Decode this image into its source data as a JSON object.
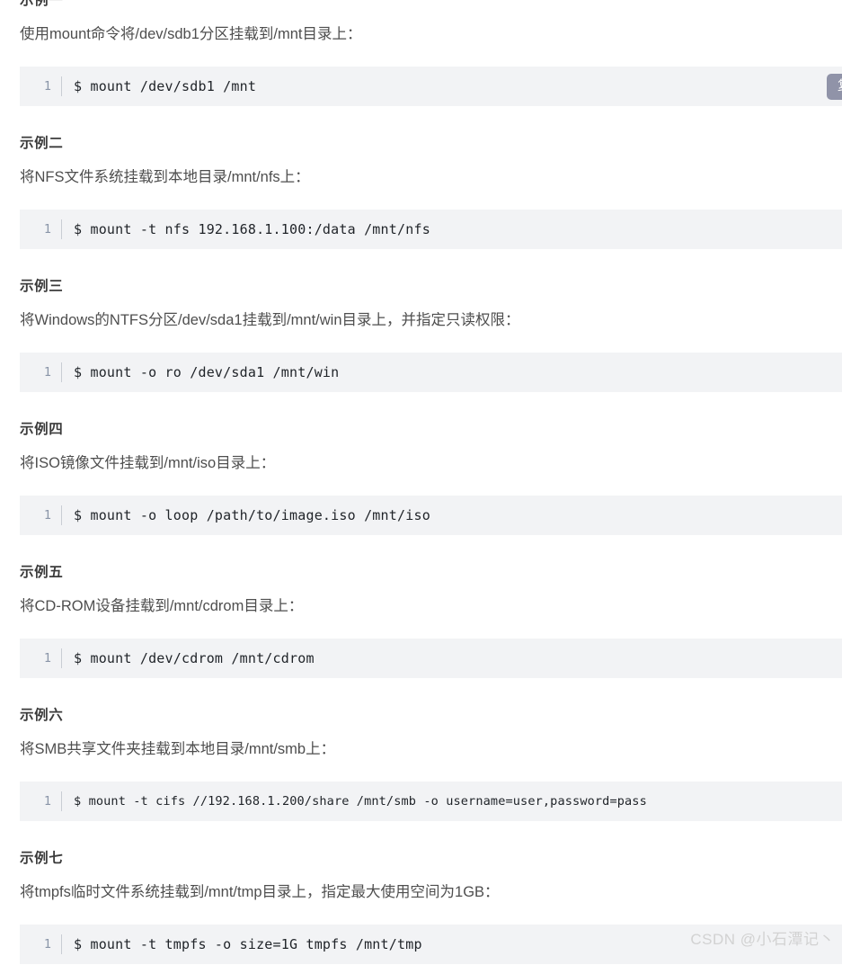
{
  "sections": [
    {
      "heading": "示例一",
      "description": "使用mount命令将/dev/sdb1分区挂载到/mnt目录上：",
      "code": {
        "line_number": "1",
        "text": "$ mount /dev/sdb1 /mnt",
        "size": "normal"
      },
      "copy_button_label": "复制"
    },
    {
      "heading": "示例二",
      "description": "将NFS文件系统挂载到本地目录/mnt/nfs上：",
      "code": {
        "line_number": "1",
        "text": "$ mount -t nfs 192.168.1.100:/data /mnt/nfs",
        "size": "normal"
      }
    },
    {
      "heading": "示例三",
      "description": "将Windows的NTFS分区/dev/sda1挂载到/mnt/win目录上，并指定只读权限：",
      "code": {
        "line_number": "1",
        "text": "$ mount -o ro /dev/sda1 /mnt/win",
        "size": "normal"
      }
    },
    {
      "heading": "示例四",
      "description": "将ISO镜像文件挂载到/mnt/iso目录上：",
      "code": {
        "line_number": "1",
        "text": "$ mount -o loop /path/to/image.iso /mnt/iso",
        "size": "normal"
      }
    },
    {
      "heading": "示例五",
      "description": "将CD-ROM设备挂载到/mnt/cdrom目录上：",
      "code": {
        "line_number": "1",
        "text": "$ mount /dev/cdrom /mnt/cdrom",
        "size": "normal"
      }
    },
    {
      "heading": "示例六",
      "description": "将SMB共享文件夹挂载到本地目录/mnt/smb上：",
      "code": {
        "line_number": "1",
        "text": "$ mount -t cifs //192.168.1.200/share /mnt/smb -o username=user,password=pass",
        "size": "small"
      }
    },
    {
      "heading": "示例七",
      "description": "将tmpfs临时文件系统挂载到/mnt/tmp目录上，指定最大使用空间为1GB：",
      "code": {
        "line_number": "1",
        "text": "$ mount -t tmpfs -o size=1G tmpfs /mnt/tmp",
        "size": "normal"
      }
    }
  ],
  "watermark": "CSDN @小石潭记丶",
  "colors": {
    "page_background": "#ffffff",
    "code_background": "#f2f3f5",
    "heading_text": "#3b3b3b",
    "body_text": "#4e4e4e",
    "code_text": "#1f2328",
    "line_number": "#8a95a8",
    "copy_button": "#9093a8",
    "watermark": "#d2d2d2"
  }
}
